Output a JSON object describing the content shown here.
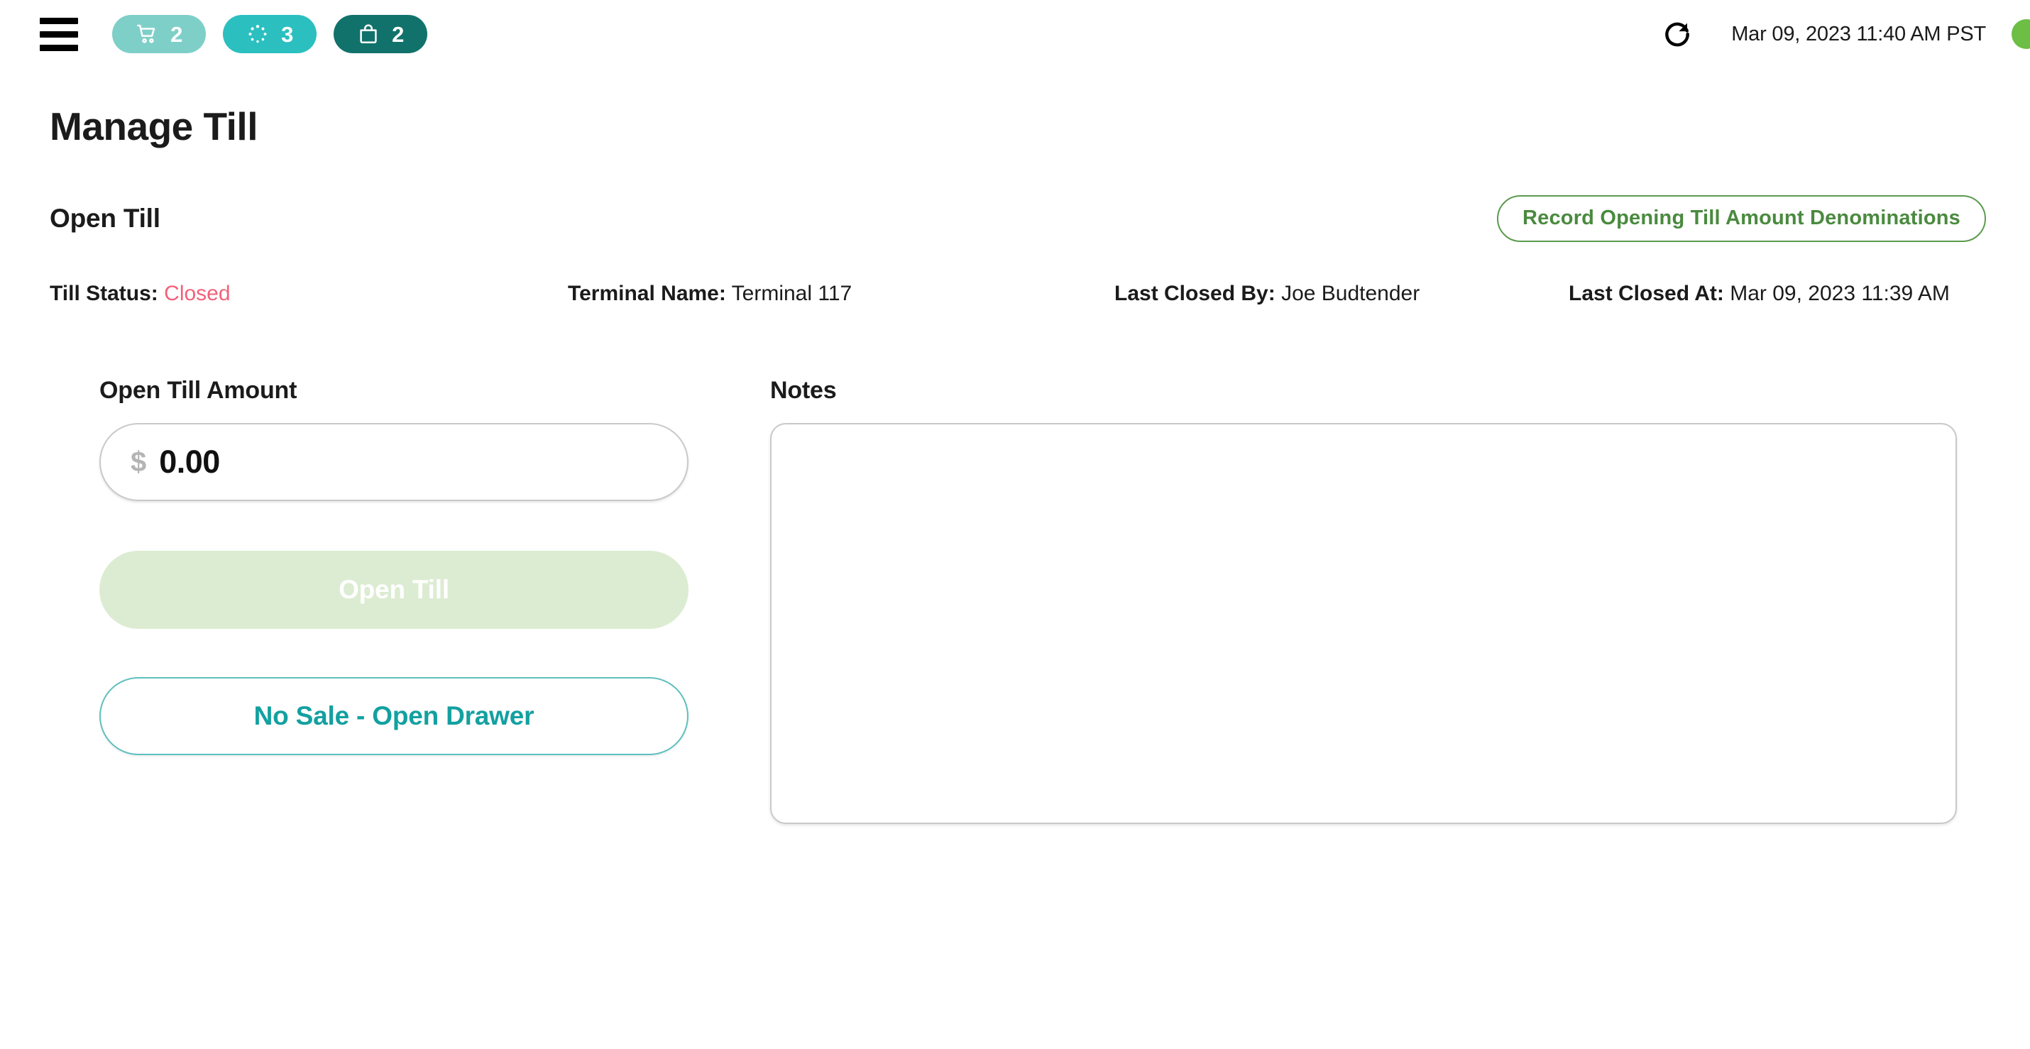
{
  "topbar": {
    "menu_icon": "hamburger-menu-icon",
    "badges": [
      {
        "icon": "shopping-cart-icon",
        "count": "2",
        "color": "#7ecfc8"
      },
      {
        "icon": "loading-spinner-icon",
        "count": "3",
        "color": "#2bbfc0"
      },
      {
        "icon": "shopping-bag-icon",
        "count": "2",
        "color": "#11726b"
      }
    ],
    "refresh_icon": "refresh-icon",
    "timestamp": "Mar 09, 2023 11:40 AM PST",
    "status_dot_color": "#6cbe45"
  },
  "page": {
    "title": "Manage Till",
    "section_title": "Open Till",
    "record_button_label": "Record Opening Till Amount Denominations",
    "meta": [
      {
        "label": "Till Status:",
        "value": "Closed",
        "state": "closed"
      },
      {
        "label": "Terminal Name:",
        "value": "Terminal 117",
        "state": "normal"
      },
      {
        "label": "Last Closed By:",
        "value": "Joe Budtender",
        "state": "normal"
      },
      {
        "label": "Last Closed At:",
        "value": "Mar 09, 2023 11:39 AM",
        "state": "normal"
      }
    ],
    "amount": {
      "label": "Open Till Amount",
      "currency_symbol": "$",
      "value": "0.00",
      "placeholder": "0.00"
    },
    "notes": {
      "label": "Notes",
      "value": "",
      "placeholder": ""
    },
    "open_till_button_label": "Open Till",
    "no_sale_button_label": "No Sale - Open Drawer"
  },
  "colors": {
    "teal_accent": "#13a0a0",
    "green_accent": "#4a8a3f",
    "status_closed": "#f4607a",
    "status_online": "#6cbe45"
  }
}
